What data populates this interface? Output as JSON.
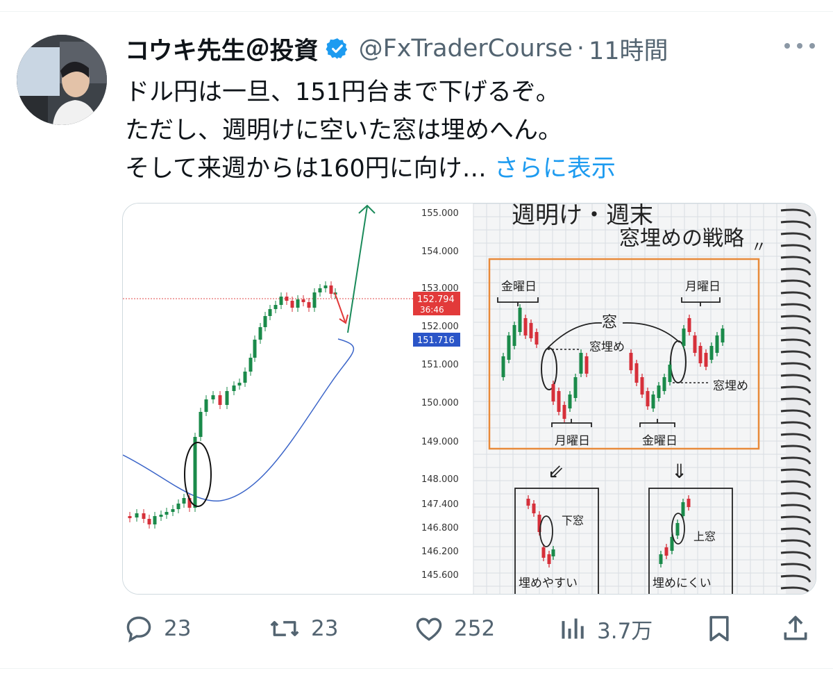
{
  "tweet": {
    "display_name": "コウキ先生＠投資",
    "handle": "@FxTraderCourse",
    "separator": "·",
    "time": "11時間",
    "lines": [
      "ドル円は一旦、151円台まで下げるぞ。",
      "ただし、週明けに空いた窓は埋めへん。",
      "そして来週からは160円に向け…"
    ],
    "show_more": "さらに表示"
  },
  "media": {
    "price_axis": [
      "155.000",
      "154.000",
      "153.000",
      "152.000",
      "151.000",
      "150.000",
      "149.000",
      "148.000",
      "147.400",
      "146.800",
      "146.200",
      "145.600"
    ],
    "current_price": "152.794",
    "countdown": "36:46",
    "ma_price": "151.716",
    "notebook": {
      "title_line1": "週明け・週末",
      "title_line2": "窓埋めの戦略",
      "friday_left": "金曜日",
      "monday_right": "月曜日",
      "window": "窓",
      "fill_left": "窓埋め",
      "fill_right": "窓埋め",
      "monday_bottom": "月曜日",
      "friday_bottom": "金曜日",
      "gap_down": "下窓",
      "gap_up": "上窓",
      "easy_fill": "埋めやすい",
      "hard_fill": "埋めにくい"
    },
    "colors": {
      "bull": "#1a8a4a",
      "bear": "#d6303a",
      "ma": "#3a64c8",
      "frame": "#e88a3a"
    }
  },
  "actions": {
    "replies": "23",
    "retweets": "23",
    "likes": "252",
    "views": "3.7万"
  }
}
